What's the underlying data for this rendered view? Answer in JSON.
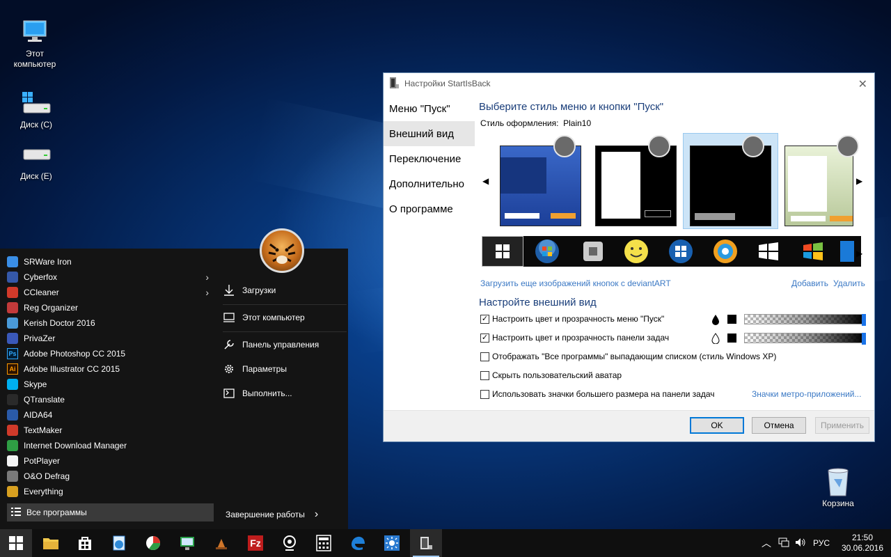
{
  "desktop": {
    "icons": [
      {
        "label": "Этот\nкомпьютер"
      },
      {
        "label": "Диск (C)"
      },
      {
        "label": "Диск (E)"
      },
      {
        "label": "Корзина"
      }
    ]
  },
  "start_menu": {
    "programs": [
      {
        "label": "SRWare Iron",
        "color": "#3a8ee6"
      },
      {
        "label": "Cyberfox",
        "color": "#3558a8",
        "submenu": true
      },
      {
        "label": "CCleaner",
        "color": "#d23a2a",
        "submenu": true
      },
      {
        "label": "Reg Organizer",
        "color": "#c23a3a"
      },
      {
        "label": "Kerish Doctor 2016",
        "color": "#4a9ad8"
      },
      {
        "label": "PrivaZer",
        "color": "#3a58b8"
      },
      {
        "label": "Adobe Photoshop CC 2015",
        "color": "#001d34",
        "badge": "Ps"
      },
      {
        "label": "Adobe Illustrator CC 2015",
        "color": "#2b1200",
        "badge": "Ai"
      },
      {
        "label": "Skype",
        "color": "#00aff0"
      },
      {
        "label": "QTranslate",
        "color": "#2a2a2a"
      },
      {
        "label": "AIDA64",
        "color": "#2a5aa8"
      },
      {
        "label": "TextMaker",
        "color": "#d03a2a"
      },
      {
        "label": "Internet Download Manager",
        "color": "#2f9e44"
      },
      {
        "label": "PotPlayer",
        "color": "#f4f4f4"
      },
      {
        "label": "O&O Defrag",
        "color": "#7a7a7a"
      },
      {
        "label": "Everything",
        "color": "#d8a020"
      }
    ],
    "all_programs": "Все программы",
    "right_items": [
      {
        "label": "Загрузки",
        "icon": "download-icon"
      },
      {
        "label": "Этот компьютер",
        "icon": "computer-icon"
      },
      {
        "label": "Панель управления",
        "icon": "wrench-icon"
      },
      {
        "label": "Параметры",
        "icon": "gear-icon"
      },
      {
        "label": "Выполнить...",
        "icon": "run-icon"
      }
    ],
    "shutdown": "Завершение работы"
  },
  "taskbar": {
    "language": "РУС",
    "time": "21:50",
    "date": "30.06.2016"
  },
  "dialog": {
    "title": "Настройки StartIsBack",
    "nav": [
      {
        "label": "Меню \"Пуск\""
      },
      {
        "label": "Внешний вид",
        "selected": true
      },
      {
        "label": "Переключение"
      },
      {
        "label": "Дополнительно"
      },
      {
        "label": "О программе"
      }
    ],
    "style_heading": "Выберите стиль меню и кнопки \"Пуск\"",
    "style_label": "Стиль оформления:",
    "style_value": "Plain10",
    "deviantart_link": "Загрузить еще изображений кнопок с deviantART",
    "add_link": "Добавить",
    "remove_link": "Удалить",
    "appearance_heading": "Настройте внешний вид",
    "options": [
      {
        "label": "Настроить цвет и прозрачность меню \"Пуск\"",
        "checked": true
      },
      {
        "label": "Настроить цвет и прозрачность панели задач",
        "checked": true
      },
      {
        "label": "Отображать \"Все программы\" выпадающим списком (стиль Windows XP)",
        "checked": false
      },
      {
        "label": "Скрыть пользовательский аватар",
        "checked": false
      },
      {
        "label": "Использовать значки большего размера на панели задач",
        "checked": false
      }
    ],
    "metro_link": "Значки метро-приложений...",
    "ok": "OK",
    "cancel": "Отмена",
    "apply": "Применить"
  }
}
